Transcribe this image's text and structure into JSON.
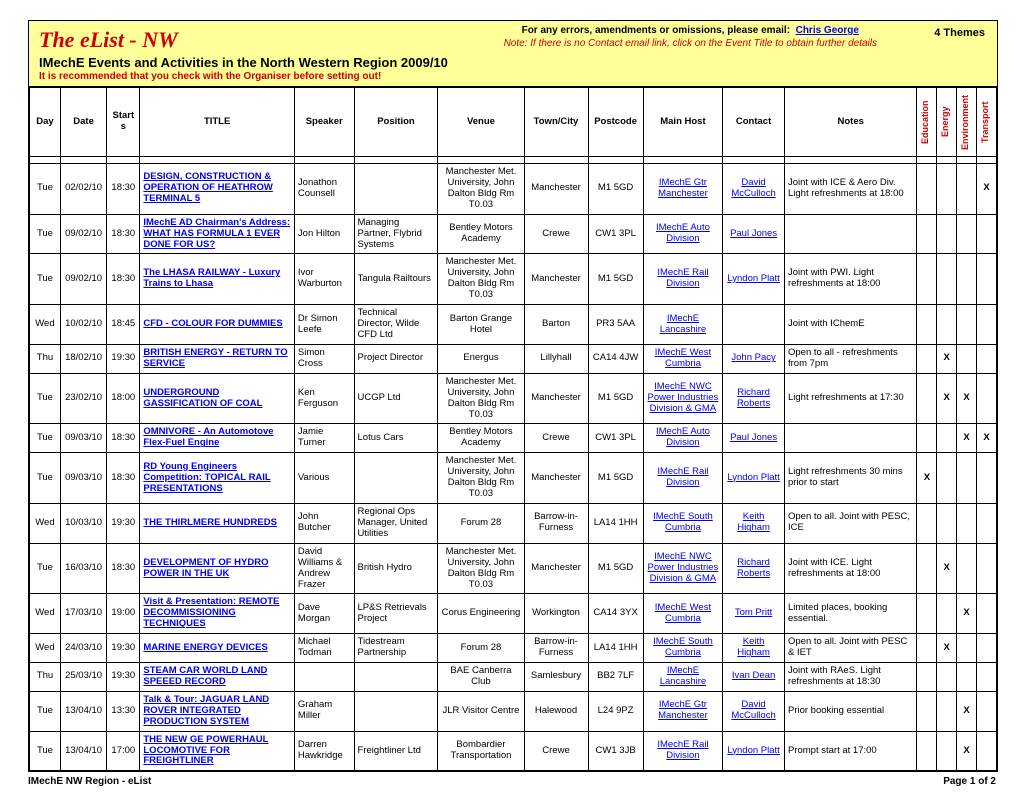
{
  "header": {
    "title": "The eList - NW",
    "subtitle": "IMechE Events and Activities in the North Western Region 2009/10",
    "warning": "It is recommended that you check with the Organiser before setting out!",
    "errors_label": "For any errors, amendments or omissions, please email:",
    "errors_contact": "Chris George",
    "note": "Note: If there is no Contact email link, click on the Event Title to obtain further details",
    "themes_label": "4 Themes"
  },
  "columns": {
    "day": "Day",
    "date": "Date",
    "starts": "Starts",
    "title": "TITLE",
    "speaker": "Speaker",
    "position": "Position",
    "venue": "Venue",
    "town": "Town/City",
    "postcode": "Postcode",
    "host": "Main Host",
    "contact": "Contact",
    "notes": "Notes",
    "themes": [
      "Education",
      "Energy",
      "Environment",
      "Transport"
    ]
  },
  "rows": [
    {
      "day": "Tue",
      "date": "02/02/10",
      "starts": "18:30",
      "title": "DESIGN, CONSTRUCTION & OPERATION OF HEATHROW TERMINAL 5",
      "speaker": "Jonathon Counsell",
      "position": "",
      "venue": "Manchester Met. University, John Dalton Bldg Rm T0.03",
      "town": "Manchester",
      "post": "M1 5GD",
      "host": "IMechE Gtr Manchester",
      "contact": "David McCulloch",
      "notes": "Joint with ICE & Aero Div. Light refreshments at 18:00",
      "t": [
        "",
        "",
        "",
        "X"
      ]
    },
    {
      "day": "Tue",
      "date": "09/02/10",
      "starts": "18:30",
      "title": "IMechE AD Chairman's Address: WHAT HAS FORMULA 1 EVER DONE FOR US?",
      "speaker": "Jon Hilton",
      "position": "Managing Partner, Flybrid Systems",
      "venue": "Bentley Motors Academy",
      "town": "Crewe",
      "post": "CW1 3PL",
      "host": "IMechE Auto Division",
      "contact": "Paul Jones",
      "notes": "",
      "t": [
        "",
        "",
        "",
        ""
      ]
    },
    {
      "day": "Tue",
      "date": "09/02/10",
      "starts": "18:30",
      "title": "The LHASA RAILWAY - Luxury Trains to Lhasa",
      "speaker": "Ivor Warburton",
      "position": "Tangula Railtours",
      "venue": "Manchester Met. University, John Dalton Bldg Rm T0.03",
      "town": "Manchester",
      "post": "M1 5GD",
      "host": "IMechE Rail Division",
      "contact": "Lyndon Platt",
      "notes": "Joint with PWI. Light refreshments at 18:00",
      "t": [
        "",
        "",
        "",
        ""
      ]
    },
    {
      "day": "Wed",
      "date": "10/02/10",
      "starts": "18:45",
      "title": "CFD - COLOUR FOR DUMMIES",
      "speaker": "Dr Simon Leefe",
      "position": "Technical Director, Wilde CFD Ltd",
      "venue": "Barton Grange Hotel",
      "town": "Barton",
      "post": "PR3 5AA",
      "host": "IMechE Lancashire",
      "contact": "",
      "notes": "Joint with IChemE",
      "t": [
        "",
        "",
        "",
        ""
      ]
    },
    {
      "day": "Thu",
      "date": "18/02/10",
      "starts": "19:30",
      "title": "BRITISH ENERGY - RETURN TO SERVICE",
      "speaker": "Simon Cross",
      "position": "Project Director",
      "venue": "Energus",
      "town": "Lillyhall",
      "post": "CA14 4JW",
      "host": "IMechE West Cumbria",
      "contact": "John Pacy",
      "notes": "Open to all - refreshments from 7pm",
      "t": [
        "",
        "X",
        "",
        ""
      ]
    },
    {
      "day": "Tue",
      "date": "23/02/10",
      "starts": "18:00",
      "title": "UNDERGROUND GASSIFICATION OF COAL",
      "speaker": "Ken Ferguson",
      "position": "UCGP Ltd",
      "venue": "Manchester Met. University, John Dalton Bldg Rm T0.03",
      "town": "Manchester",
      "post": "M1 5GD",
      "host": "IMechE NWC Power Industries Division & GMA",
      "contact": "Richard Roberts",
      "notes": "Light refreshments at 17:30",
      "t": [
        "",
        "X",
        "X",
        ""
      ]
    },
    {
      "day": "Tue",
      "date": "09/03/10",
      "starts": "18:30",
      "title": "OMNIVORE - An Automotove Flex-Fuel Engine",
      "speaker": "Jamie Turner",
      "position": "Lotus Cars",
      "venue": "Bentley Motors Academy",
      "town": "Crewe",
      "post": "CW1 3PL",
      "host": "IMechE Auto Division",
      "contact": "Paul Jones",
      "notes": "",
      "t": [
        "",
        "",
        "X",
        "X"
      ]
    },
    {
      "day": "Tue",
      "date": "09/03/10",
      "starts": "18:30",
      "title": "RD Young Engineers Competition: TOPICAL RAIL PRESENTATIONS",
      "speaker": "Various",
      "position": "",
      "venue": "Manchester Met. University, John Dalton Bldg Rm T0.03",
      "town": "Manchester",
      "post": "M1 5GD",
      "host": "IMechE Rail Division",
      "contact": "Lyndon Platt",
      "notes": "Light refreshments 30 mins prior to start",
      "t": [
        "X",
        "",
        "",
        ""
      ]
    },
    {
      "day": "Wed",
      "date": "10/03/10",
      "starts": "19:30",
      "title": "THE THIRLMERE HUNDREDS",
      "speaker": "John Butcher",
      "position": "Regional Ops Manager, United Utilities",
      "venue": "Forum 28",
      "town": "Barrow-in-Furness",
      "post": "LA14 1HH",
      "host": "IMechE South Cumbria",
      "contact": "Keith Higham",
      "notes": "Open to all. Joint with PESC, ICE",
      "t": [
        "",
        "",
        "",
        ""
      ]
    },
    {
      "day": "Tue",
      "date": "16/03/10",
      "starts": "18:30",
      "title": "DEVELOPMENT OF HYDRO POWER IN THE UK",
      "speaker": "David Williams & Andrew Frazer",
      "position": "British Hydro",
      "venue": "Manchester Met. University, John Dalton Bldg Rm T0.03",
      "town": "Manchester",
      "post": "M1 5GD",
      "host": "IMechE NWC Power Industries Division & GMA",
      "contact": "Richard Roberts",
      "notes": "Joint with ICE. Light refreshments at 18:00",
      "t": [
        "",
        "X",
        "",
        ""
      ]
    },
    {
      "day": "Wed",
      "date": "17/03/10",
      "starts": "19:00",
      "title": "Visit & Presentation: REMOTE DECOMMISSIONING TECHNIQUES",
      "speaker": "Dave Morgan",
      "position": "LP&S Retrievals Project",
      "venue": "Corus Engineering",
      "town": "Workington",
      "post": "CA14 3YX",
      "host": "IMechE West Cumbria",
      "contact": "Tom Pritt",
      "notes": "Limited places, booking essential.",
      "t": [
        "",
        "",
        "X",
        ""
      ]
    },
    {
      "day": "Wed",
      "date": "24/03/10",
      "starts": "19:30",
      "title": "MARINE ENERGY DEVICES",
      "speaker": "Michael Todman",
      "position": "Tidestream Partnership",
      "venue": "Forum 28",
      "town": "Barrow-in-Furness",
      "post": "LA14 1HH",
      "host": "IMechE South Cumbria",
      "contact": "Keith Higham",
      "notes": "Open to all. Joint with PESC & IET",
      "t": [
        "",
        "X",
        "",
        ""
      ]
    },
    {
      "day": "Thu",
      "date": "25/03/10",
      "starts": "19:30",
      "title": "STEAM CAR WORLD LAND SPEEED RECORD",
      "speaker": "",
      "position": "",
      "venue": "BAE Canberra Club",
      "town": "Samlesbury",
      "post": "BB2 7LF",
      "host": "IMechE Lancashire",
      "contact": "Ivan Dean",
      "notes": "Joint with RAeS. Light refreshments at 18:30",
      "t": [
        "",
        "",
        "",
        ""
      ]
    },
    {
      "day": "Tue",
      "date": "13/04/10",
      "starts": "13:30",
      "title": "Talk & Tour: JAGUAR LAND ROVER INTEGRATED PRODUCTION SYSTEM",
      "speaker": "Graham Miller",
      "position": "",
      "venue": "JLR Visitor Centre",
      "town": "Halewood",
      "post": "L24 9PZ",
      "host": "IMechE Gtr Manchester",
      "contact": "David McCulloch",
      "notes": "Prior booking essential",
      "t": [
        "",
        "",
        "X",
        ""
      ]
    },
    {
      "day": "Tue",
      "date": "13/04/10",
      "starts": "17:00",
      "title": "THE NEW GE POWERHAUL LOCOMOTIVE FOR FREIGHTLINER",
      "speaker": "Darren Hawkridge",
      "position": "Freightliner Ltd",
      "venue": "Bombardier Transportation",
      "town": "Crewe",
      "post": "CW1 3JB",
      "host": "IMechE Rail Division",
      "contact": "Lyndon Platt",
      "notes": "Prompt start at 17:00",
      "t": [
        "",
        "",
        "X",
        ""
      ]
    }
  ],
  "footer": {
    "left": "IMechE NW Region - eList",
    "right": "Page 1 of 2"
  }
}
